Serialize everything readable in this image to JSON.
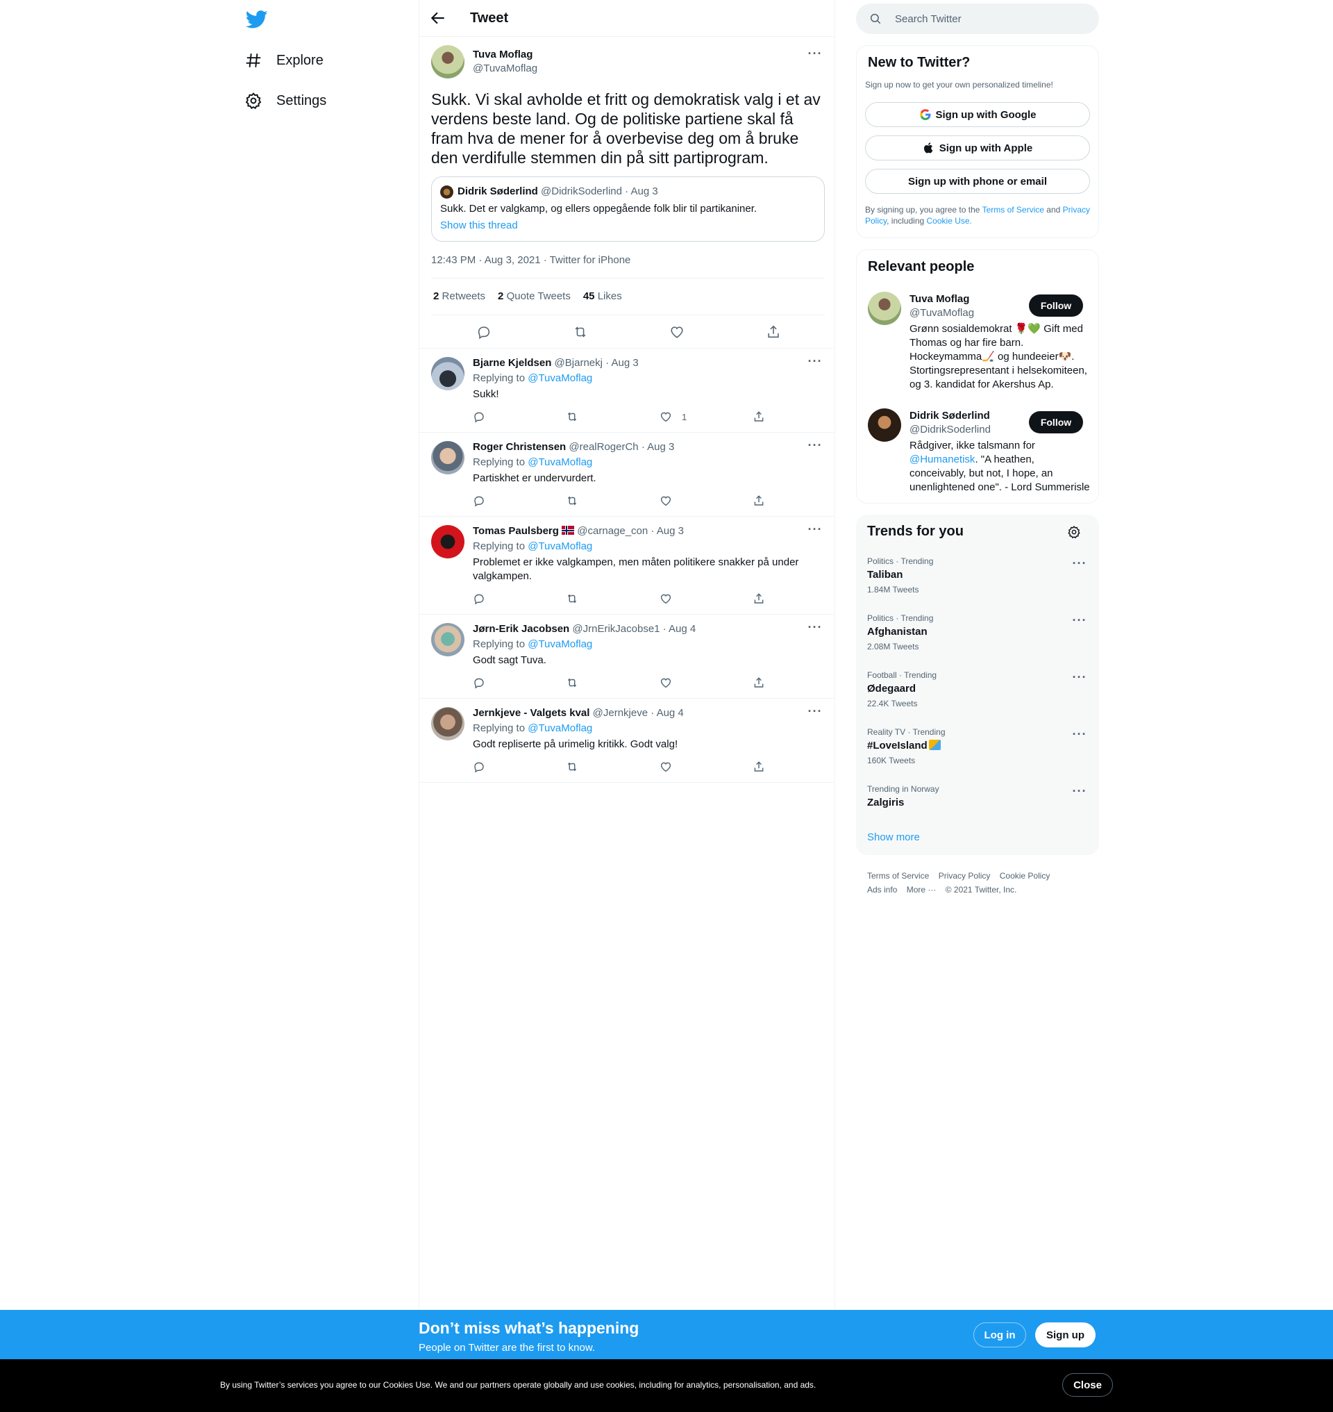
{
  "nav": {
    "explore_label": "Explore",
    "settings_label": "Settings"
  },
  "header": {
    "title": "Tweet"
  },
  "main_tweet": {
    "author_name": "Tuva Moflag",
    "author_handle": "@TuvaMoflag",
    "text": "Sukk. Vi skal avholde et fritt og demokratisk valg i et av verdens beste land. Og de politiske partiene skal få fram hva de mener for å overbevise deg om å bruke den verdifulle stemmen din på sitt partiprogram.",
    "quote": {
      "author_name": "Didrik Søderlind",
      "author_handle": "@DidrikSoderlind",
      "date": "· Aug 3",
      "text": "Sukk. Det er valgkamp, og ellers oppegående folk blir til partikaniner.",
      "link": "Show this thread"
    },
    "meta": "12:43 PM · Aug 3, 2021 · Twitter for iPhone",
    "stats": {
      "retweets_count": "2",
      "retweets_label": "Retweets",
      "quotes_count": "2",
      "quotes_label": "Quote Tweets",
      "likes_count": "45",
      "likes_label": "Likes"
    }
  },
  "replies": [
    {
      "name": "Bjarne Kjeldsen",
      "handle": "@Bjarnekj",
      "date": "· Aug 3",
      "replying_prefix": "Replying to",
      "replying_to": "@TuvaMoflag",
      "text": "Sukk!",
      "like_count": "1"
    },
    {
      "name": "Roger Christensen",
      "handle": "@realRogerCh",
      "date": "· Aug 3",
      "replying_prefix": "Replying to",
      "replying_to": "@TuvaMoflag",
      "text": "Partiskhet er undervurdert.",
      "like_count": ""
    },
    {
      "name": "Tomas Paulsberg",
      "handle": "@carnage_con",
      "date": "· Aug 3",
      "replying_prefix": "Replying to",
      "replying_to": "@TuvaMoflag",
      "text": "Problemet er ikke valgkampen, men måten politikere snakker på under valgkampen.",
      "like_count": ""
    },
    {
      "name": "Jørn-Erik Jacobsen",
      "handle": "@JrnErikJacobse1",
      "date": "· Aug 4",
      "replying_prefix": "Replying to",
      "replying_to": "@TuvaMoflag",
      "text": "Godt sagt Tuva.",
      "like_count": ""
    },
    {
      "name": "Jernkjeve - Valgets kval",
      "handle": "@Jernkjeve",
      "date": "· Aug 4",
      "replying_prefix": "Replying to",
      "replying_to": "@TuvaMoflag",
      "text": "Godt repliserte på urimelig kritikk. Godt valg!",
      "like_count": ""
    }
  ],
  "search": {
    "placeholder": "Search Twitter"
  },
  "new_to_twitter": {
    "title": "New to Twitter?",
    "subtitle": "Sign up now to get your own personalized timeline!",
    "google_label": "Sign up with Google",
    "apple_label": "Sign up with Apple",
    "phone_label": "Sign up with phone or email",
    "legal_prefix": "By signing up, you agree to the",
    "terms_link": "Terms of Service",
    "legal_and": "and",
    "privacy_link": "Privacy Policy",
    "legal_including": ", including",
    "cookie_link": "Cookie Use."
  },
  "relevant_people": {
    "title": "Relevant people",
    "people": [
      {
        "name": "Tuva Moflag",
        "handle": "@TuvaMoflag",
        "bio": "Grønn sosialdemokrat 🌹💚 Gift med Thomas og har fire barn. Hockeymamma🏒 og hundeeier🐶. Stortingsrepresentant i helsekomiteen, og 3. kandidat for Akershus Ap.",
        "follow_label": "Follow"
      },
      {
        "name": "Didrik Søderlind",
        "handle": "@DidrikSoderlind",
        "bio_prefix": "Rådgiver, ikke talsmann for",
        "bio_link": "@Humanetisk",
        "bio_suffix": ". \"A heathen, conceivably, but not, I hope, an unenlightened one\". - Lord Summerisle",
        "follow_label": "Follow"
      }
    ]
  },
  "trends": {
    "title": "Trends for you",
    "items": [
      {
        "context": "Politics · Trending",
        "name": "Taliban",
        "count": "1.84M Tweets"
      },
      {
        "context": "Politics · Trending",
        "name": "Afghanistan",
        "count": "2.08M Tweets"
      },
      {
        "context": "Football · Trending",
        "name": "Ødegaard",
        "count": "22.4K Tweets"
      },
      {
        "context": "Reality TV · Trending",
        "name": "#LoveIsland",
        "count": "160K Tweets"
      },
      {
        "context": "Trending in Norway",
        "name": "Zalgiris",
        "count": ""
      }
    ],
    "show_more": "Show more"
  },
  "footer": {
    "terms": "Terms of Service",
    "privacy": "Privacy Policy",
    "cookie": "Cookie Policy",
    "ads": "Ads info",
    "more": "More ···",
    "copyright": "© 2021 Twitter, Inc."
  },
  "signup_bar": {
    "title": "Don’t miss what’s happening",
    "subtitle": "People on Twitter are the first to know.",
    "login_label": "Log in",
    "signup_label": "Sign up"
  },
  "cookie_bar": {
    "text": "By using Twitter’s services you agree to our Cookies Use. We and our partners operate globally and use cookies, including for analytics, personalisation, and ads.",
    "close_label": "Close"
  }
}
